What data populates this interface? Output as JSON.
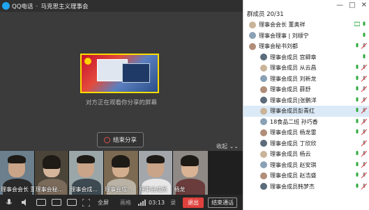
{
  "window": {
    "app_name": "QQ电话",
    "separator": "-",
    "group_name": "马克思主义理事会"
  },
  "win_controls": {
    "minimize": "—",
    "maximize": "□",
    "close": "✕"
  },
  "share": {
    "status_text": "对方正在观看你分享的屏幕",
    "end_button_label": "结束分享",
    "collapse_label": "收起 ⌄⌄"
  },
  "video_tiles": [
    {
      "label": "理事会会长 董奥祥"
    },
    {
      "label": "理事会秘..."
    },
    {
      "label": "理事会成..."
    },
    {
      "label": "理事会成..."
    },
    {
      "label": "理事会成员"
    },
    {
      "label": "杨龙"
    }
  ],
  "controls": {
    "fullscreen_label": "全屏",
    "palette_label": "画格",
    "timer": "03:13",
    "record_label": "录",
    "exit_label": "退出",
    "convert_label": "结束通话"
  },
  "members": {
    "header": "群成员 20/31",
    "items": [
      {
        "name": "理事会会长  董奥祥"
      },
      {
        "name": "理事会理事 | 刘顺宁"
      },
      {
        "name": "理事会秘书刘都"
      },
      {
        "name": "理事会成员  宫卿章"
      },
      {
        "name": "理事会成员 从云昌"
      },
      {
        "name": "理事会成员 刘新龙"
      },
      {
        "name": "理事会成员 薛舒"
      },
      {
        "name": "理事会成员|张鹏洋"
      },
      {
        "name": "理事会成员彭青红"
      },
      {
        "name": "18食品二班 孙巧香"
      },
      {
        "name": "理事会成员  杨龙雷"
      },
      {
        "name": "理事会成员  丁欣欣"
      },
      {
        "name": "理事会成员  杨云"
      },
      {
        "name": "理事会成员 赵安琪"
      },
      {
        "name": "理事会成员 赵浩盛"
      },
      {
        "name": "理事会成员韩梦杰"
      }
    ]
  },
  "colors": {
    "accent_share_border": "#ffdd00",
    "exit_red": "#e0413d",
    "selected_row": "#dceaf7",
    "mic_green": "#2eaa3c"
  }
}
